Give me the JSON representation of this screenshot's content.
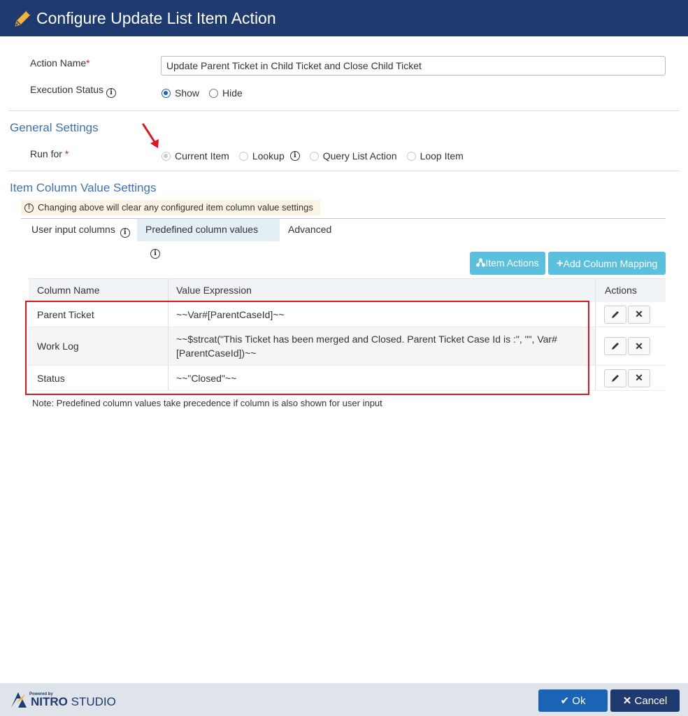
{
  "window": {
    "title": "Configure Update List Item Action"
  },
  "action_name": {
    "label": "Action Name",
    "required_mark": "*",
    "value": "Update Parent Ticket in Child Ticket and Close Child Ticket"
  },
  "execution_status": {
    "label": "Execution Status",
    "options": [
      "Show",
      "Hide"
    ],
    "selected": "Show"
  },
  "general_settings": {
    "title": "General Settings",
    "run_for": {
      "label": "Run for",
      "required_mark": "*",
      "options": [
        "Current Item",
        "Lookup",
        "Query List Action",
        "Loop Item"
      ],
      "selected": "Current Item",
      "disabled": true
    }
  },
  "item_column_value_settings": {
    "title": "Item Column Value Settings",
    "warning": "Changing above will clear any configured item column value settings",
    "tabs": [
      "User input columns",
      "Predefined column values",
      "Advanced"
    ],
    "active_tab": "Predefined column values",
    "buttons": {
      "item_actions": "Item Actions",
      "add_column_mapping": "Add Column Mapping"
    },
    "table": {
      "headers": [
        "Column Name",
        "Value Expression",
        "Actions"
      ],
      "rows": [
        {
          "column": "Parent Ticket",
          "expression": "~~Var#[ParentCaseId]~~"
        },
        {
          "column": "Work Log",
          "expression": "~~$strcat(\"This Ticket has been merged and Closed. Parent Ticket Case Id is :\", \"\", Var# [ParentCaseId])~~"
        },
        {
          "column": "Status",
          "expression": "~~\"Closed\"~~"
        }
      ]
    },
    "note": "Note: Predefined column values take precedence if column is also shown for user input"
  },
  "footer": {
    "brand_powered": "Powered by",
    "brand_name_a": "NITRO",
    "brand_name_b": " STUDIO",
    "ok_label": "Ok",
    "cancel_label": "Cancel"
  },
  "colors": {
    "header_bg": "#1e3a6e",
    "section_title": "#3d72b8",
    "cyan_button": "#5bbfde",
    "highlight": "#e0141e",
    "arrow": "#e0141e"
  },
  "icons": [
    "pencil-icon",
    "info-icon",
    "warning-icon",
    "sitemap-icon",
    "plus-icon",
    "edit-icon",
    "delete-icon",
    "check-icon",
    "close-icon",
    "nitro-logo"
  ]
}
